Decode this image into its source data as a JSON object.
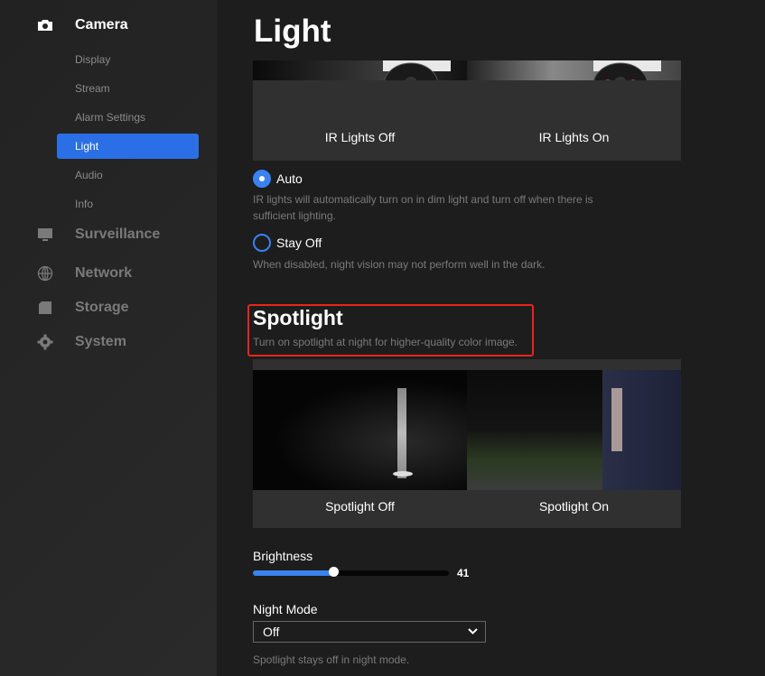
{
  "sidebar": {
    "sections": [
      {
        "label": "Camera",
        "icon": "camera-icon",
        "active": true
      },
      {
        "label": "Surveillance",
        "icon": "monitor-icon",
        "active": false
      },
      {
        "label": "Network",
        "icon": "globe-icon",
        "active": false
      },
      {
        "label": "Storage",
        "icon": "sd-card-icon",
        "active": false
      },
      {
        "label": "System",
        "icon": "gear-icon",
        "active": false
      }
    ],
    "camera_items": [
      {
        "label": "Display"
      },
      {
        "label": "Stream"
      },
      {
        "label": "Alarm Settings"
      },
      {
        "label": "Light",
        "active": true
      },
      {
        "label": "Audio"
      },
      {
        "label": "Info"
      }
    ]
  },
  "main": {
    "title": "Light",
    "ir": {
      "captions": [
        "IR Lights Off",
        "IR Lights On"
      ],
      "options": [
        {
          "label": "Auto",
          "selected": true,
          "help": "IR lights will automatically turn on in dim light and turn off when there is sufficient lighting."
        },
        {
          "label": "Stay Off",
          "selected": false,
          "help": "When disabled, night vision may not perform well in the dark."
        }
      ]
    },
    "spotlight": {
      "title": "Spotlight",
      "description": "Turn on spotlight at night for higher-quality color image.",
      "captions": [
        "Spotlight Off",
        "Spotlight On"
      ],
      "brightness_label": "Brightness",
      "brightness_value": 41,
      "brightness_display": "41",
      "night_mode_label": "Night Mode",
      "night_mode_value": "Off",
      "night_mode_help": "Spotlight stays off in night mode."
    }
  },
  "colors": {
    "accent": "#2b6fe6",
    "highlight_border": "#e8251c"
  }
}
